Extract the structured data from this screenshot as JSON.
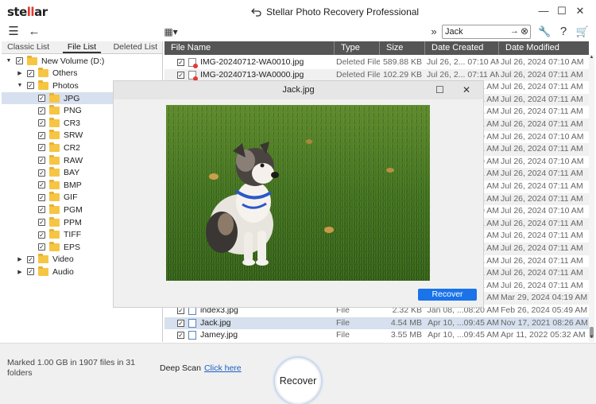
{
  "app": {
    "logo_left": "ste",
    "logo_ar": "ll",
    "logo_right": "ar",
    "title": "Stellar Photo Recovery Professional",
    "back_icon": "undo-arrow-icon",
    "minimize": "—",
    "maximize": "☐",
    "close": "✕"
  },
  "toolbar": {
    "menu_icon": "☰",
    "back_icon": "←",
    "view_icon": "▦▾",
    "expand_icon": "»",
    "search_value": "Jack",
    "search_go": "→",
    "search_clear": "⊗",
    "tools_icon": "🔧",
    "help_icon": "?",
    "cart_icon": "🛒"
  },
  "left_tabs": [
    "Classic List",
    "File List",
    "Deleted List"
  ],
  "tree": [
    {
      "label": "New Volume (D:)",
      "twisty": "▼",
      "indent": 0,
      "checked": "✓"
    },
    {
      "label": "Others",
      "twisty": "▶",
      "indent": 1,
      "checked": "✓"
    },
    {
      "label": "Photos",
      "twisty": "▼",
      "indent": 1,
      "checked": "✓"
    },
    {
      "label": "JPG",
      "twisty": "",
      "indent": 2,
      "checked": "✓",
      "selected": true
    },
    {
      "label": "PNG",
      "twisty": "",
      "indent": 2,
      "checked": "✓"
    },
    {
      "label": "CR3",
      "twisty": "",
      "indent": 2,
      "checked": "✓"
    },
    {
      "label": "SRW",
      "twisty": "",
      "indent": 2,
      "checked": "✓"
    },
    {
      "label": "CR2",
      "twisty": "",
      "indent": 2,
      "checked": "✓"
    },
    {
      "label": "RAW",
      "twisty": "",
      "indent": 2,
      "checked": "✓"
    },
    {
      "label": "BAY",
      "twisty": "",
      "indent": 2,
      "checked": "✓"
    },
    {
      "label": "BMP",
      "twisty": "",
      "indent": 2,
      "checked": "✓"
    },
    {
      "label": "GIF",
      "twisty": "",
      "indent": 2,
      "checked": "✓"
    },
    {
      "label": "PGM",
      "twisty": "",
      "indent": 2,
      "checked": "✓"
    },
    {
      "label": "PPM",
      "twisty": "",
      "indent": 2,
      "checked": "✓"
    },
    {
      "label": "TIFF",
      "twisty": "",
      "indent": 2,
      "checked": "✓"
    },
    {
      "label": "EPS",
      "twisty": "",
      "indent": 2,
      "checked": "✓"
    },
    {
      "label": "Video",
      "twisty": "▶",
      "indent": 1,
      "checked": "✓"
    },
    {
      "label": "Audio",
      "twisty": "▶",
      "indent": 1,
      "checked": "✓"
    }
  ],
  "columns": [
    "File Name",
    "Type",
    "Size",
    "Date Created",
    "Date Modified"
  ],
  "rows": [
    {
      "name": "IMG-20240712-WA0010.jpg",
      "type": "Deleted File",
      "size": "589.88 KB",
      "created": "Jul 26, 2... 07:10 AM",
      "modified": "Jul 26, 2024 07:10 AM",
      "icon": "deleted"
    },
    {
      "name": "IMG-20240713-WA0000.jpg",
      "type": "Deleted File",
      "size": "102.29 KB",
      "created": "Jul 26, 2... 07:11 AM",
      "modified": "Jul 26, 2024 07:11 AM",
      "icon": "deleted"
    },
    {
      "name": "",
      "type": "",
      "size": "",
      "created": "07:11 AM",
      "modified": "Jul 26, 2024 07:11 AM",
      "icon": ""
    },
    {
      "name": "",
      "type": "",
      "size": "",
      "created": "07:11 AM",
      "modified": "Jul 26, 2024 07:11 AM",
      "icon": ""
    },
    {
      "name": "",
      "type": "",
      "size": "",
      "created": "07:11 AM",
      "modified": "Jul 26, 2024 07:11 AM",
      "icon": ""
    },
    {
      "name": "",
      "type": "",
      "size": "",
      "created": "07:11 AM",
      "modified": "Jul 26, 2024 07:11 AM",
      "icon": ""
    },
    {
      "name": "",
      "type": "",
      "size": "",
      "created": "07:10 AM",
      "modified": "Jul 26, 2024 07:10 AM",
      "icon": ""
    },
    {
      "name": "",
      "type": "",
      "size": "",
      "created": "07:11 AM",
      "modified": "Jul 26, 2024 07:11 AM",
      "icon": ""
    },
    {
      "name": "",
      "type": "",
      "size": "",
      "created": "07:10 AM",
      "modified": "Jul 26, 2024 07:10 AM",
      "icon": ""
    },
    {
      "name": "",
      "type": "",
      "size": "",
      "created": "07:11 AM",
      "modified": "Jul 26, 2024 07:11 AM",
      "icon": ""
    },
    {
      "name": "",
      "type": "",
      "size": "",
      "created": "07:11 AM",
      "modified": "Jul 26, 2024 07:11 AM",
      "icon": ""
    },
    {
      "name": "",
      "type": "",
      "size": "",
      "created": "07:11 AM",
      "modified": "Jul 26, 2024 07:11 AM",
      "icon": ""
    },
    {
      "name": "",
      "type": "",
      "size": "",
      "created": "07:10 AM",
      "modified": "Jul 26, 2024 07:10 AM",
      "icon": ""
    },
    {
      "name": "",
      "type": "",
      "size": "",
      "created": "07:11 AM",
      "modified": "Jul 26, 2024 07:11 AM",
      "icon": ""
    },
    {
      "name": "",
      "type": "",
      "size": "",
      "created": "07:11 AM",
      "modified": "Jul 26, 2024 07:11 AM",
      "icon": ""
    },
    {
      "name": "",
      "type": "",
      "size": "",
      "created": "07:11 AM",
      "modified": "Jul 26, 2024 07:11 AM",
      "icon": ""
    },
    {
      "name": "",
      "type": "",
      "size": "",
      "created": "07:11 AM",
      "modified": "Jul 26, 2024 07:11 AM",
      "icon": ""
    },
    {
      "name": "",
      "type": "",
      "size": "",
      "created": "07:11 AM",
      "modified": "Jul 26, 2024 07:11 AM",
      "icon": ""
    },
    {
      "name": "",
      "type": "",
      "size": "",
      "created": "07:11 AM",
      "modified": "Jul 26, 2024 07:11 AM",
      "icon": ""
    },
    {
      "name": "",
      "type": "",
      "size": "",
      "created": "AM",
      "modified": "Mar 29, 2024 04:19 AM",
      "icon": ""
    },
    {
      "name": "index3.jpg",
      "type": "File",
      "size": "2.32 KB",
      "created": "Jan 08, ...08:20 AM",
      "modified": "Feb 26, 2024 05:49 AM",
      "icon": "ok"
    },
    {
      "name": "Jack.jpg",
      "type": "File",
      "size": "4.54 MB",
      "created": "Apr 10, ...09:45 AM",
      "modified": "Nov 17, 2021 08:26 AM",
      "icon": "ok",
      "selected": true
    },
    {
      "name": "Jamey.jpg",
      "type": "File",
      "size": "3.55 MB",
      "created": "Apr 10, ...09:45 AM",
      "modified": "Apr 11, 2022 05:32 AM",
      "icon": "ok"
    }
  ],
  "preview": {
    "title": "Jack.jpg",
    "maximize": "☐",
    "close": "✕",
    "recover_label": "Recover"
  },
  "bottom": {
    "marked_text": "Marked 1.00 GB in 1907 files in 31 folders",
    "deep_scan_label": "Deep Scan",
    "deep_scan_link": "Click here",
    "recover_label": "Recover"
  },
  "colors": {
    "accent": "#1a73e8",
    "header_bg": "#555555",
    "selection": "#d6e0ee",
    "folder": "#f6c544",
    "logo_accent": "#e03a2f"
  }
}
